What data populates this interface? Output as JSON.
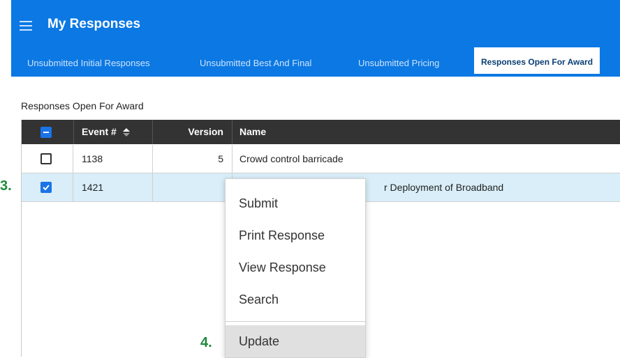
{
  "header": {
    "title": "My Responses",
    "tabs": [
      {
        "label": "Unsubmitted Initial Responses",
        "active": false
      },
      {
        "label": "Unsubmitted Best And Final",
        "active": false
      },
      {
        "label": "Unsubmitted Pricing",
        "active": false
      },
      {
        "label": "Responses Open For Award",
        "active": true
      }
    ]
  },
  "section_label": "Responses Open For Award",
  "table": {
    "columns": [
      "Event #",
      "Version",
      "Name"
    ],
    "rows": [
      {
        "event": "1138",
        "version": "5",
        "name": "Crowd control barricade",
        "checked": false
      },
      {
        "event": "1421",
        "version": "",
        "name": "r Deployment of Broadband",
        "checked": true
      }
    ]
  },
  "context_menu": {
    "items": [
      "Submit",
      "Print Response",
      "View Response",
      "Search",
      "Update"
    ]
  },
  "markers": {
    "step3": "3.",
    "step4": "4."
  },
  "colors": {
    "header_bg": "#0b78e3",
    "table_header_bg": "#333333",
    "selected_row_bg": "#d9eef8",
    "marker": "#1e8a3c",
    "checkbox_blue": "#1a73e8"
  },
  "icons": [
    "hamburger-icon",
    "sort-icon",
    "checkbox-checked-icon",
    "checkbox-minus-icon"
  ]
}
